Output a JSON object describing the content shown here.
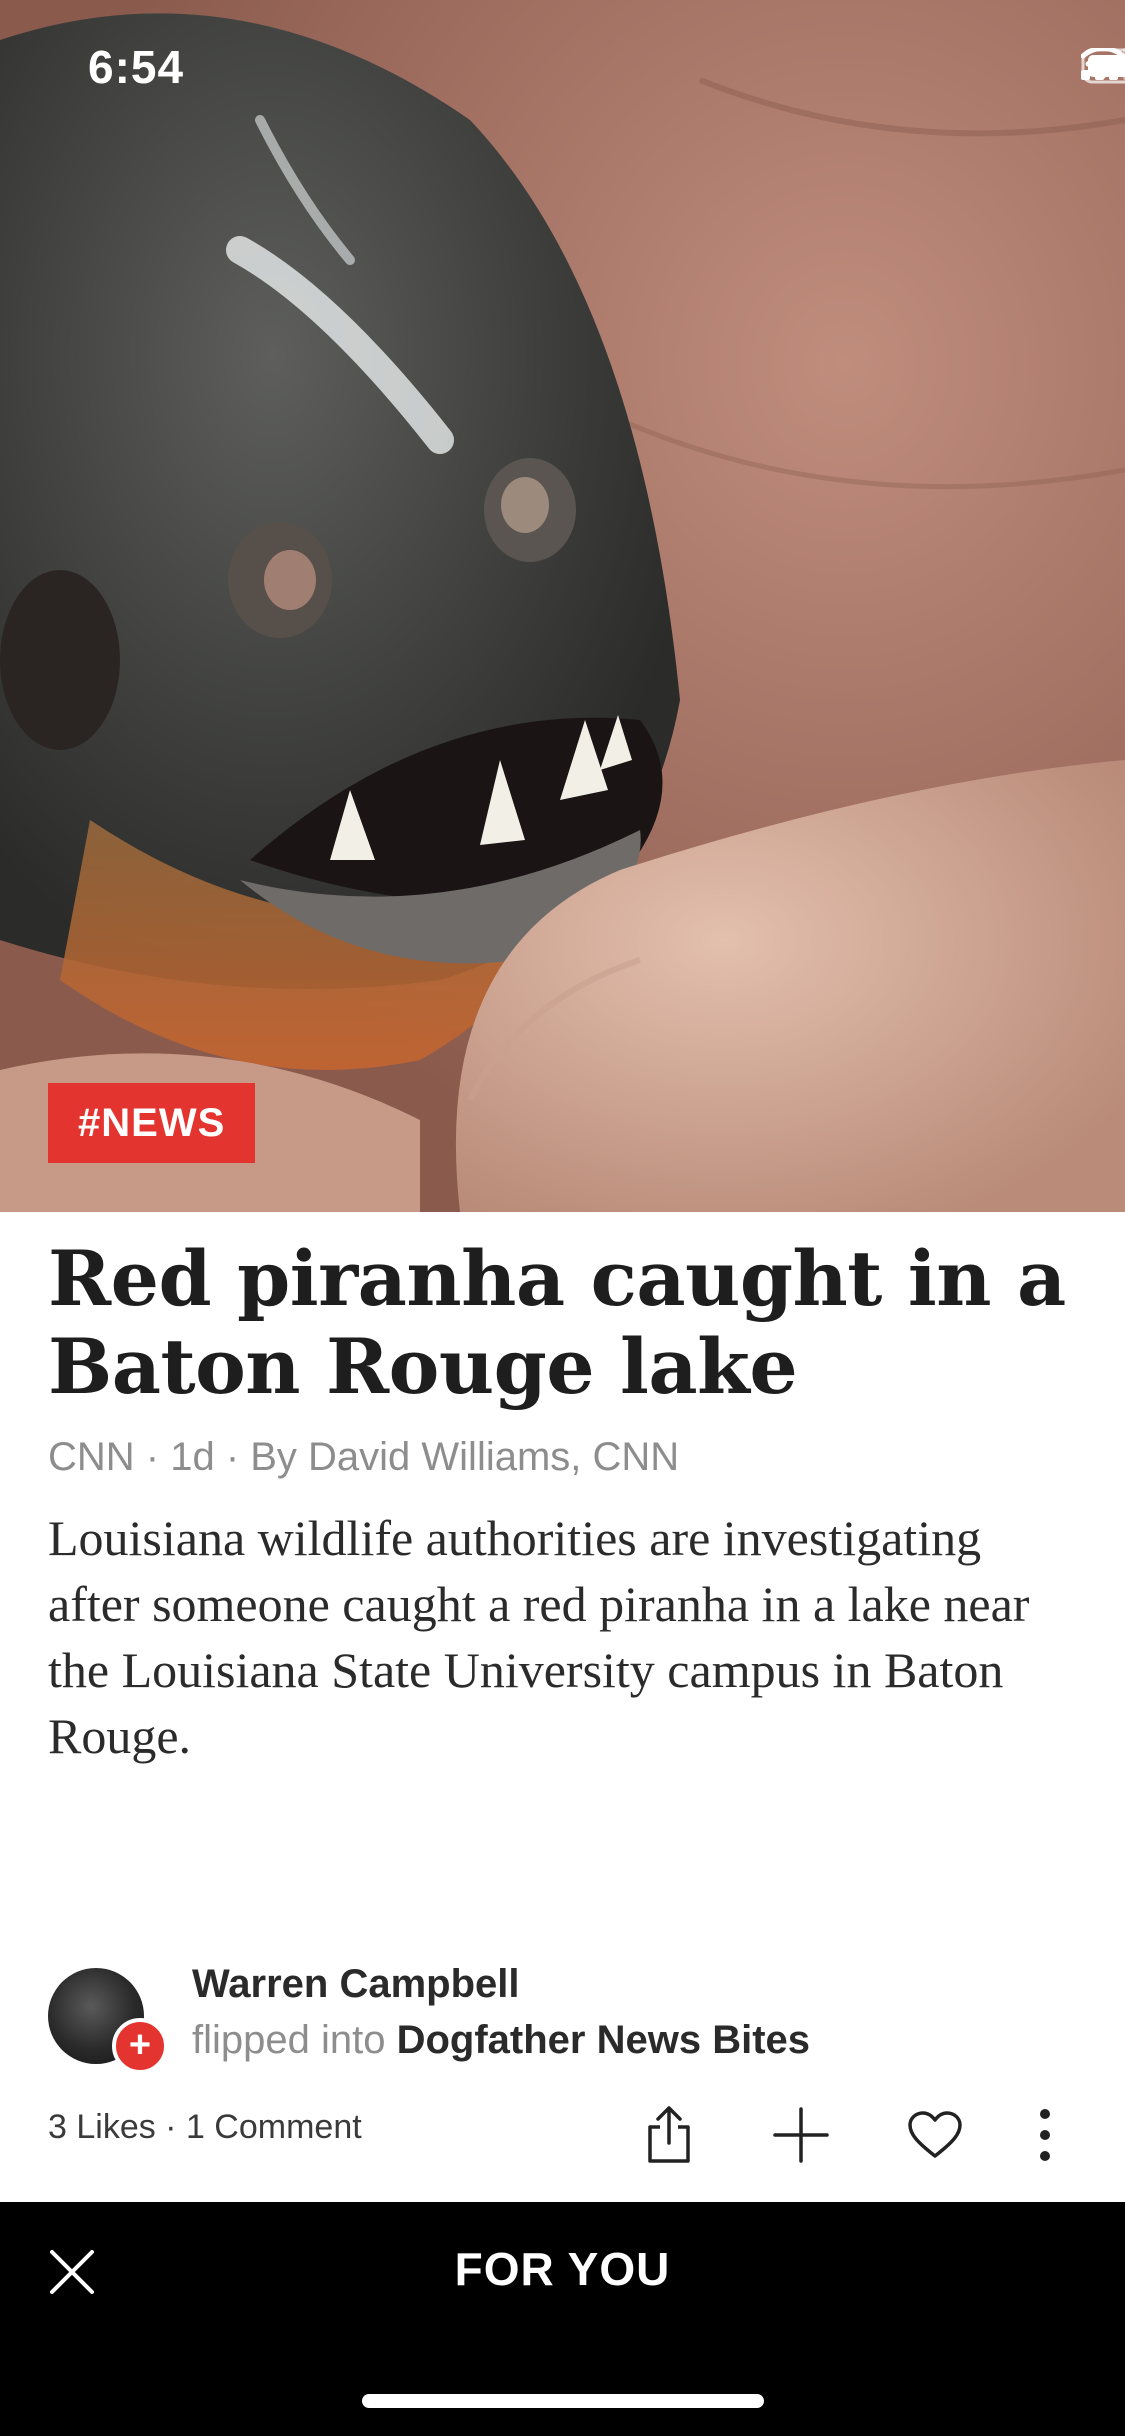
{
  "status_bar": {
    "time": "6:54"
  },
  "article": {
    "tag": "#NEWS",
    "title": "Red piranha caught in a Baton Rouge lake",
    "meta": "CNN · 1d · By David Williams, CNN",
    "summary": "Louisiana wildlife authorities are investigating after someone caught a red piranha in a lake near the Louisiana State University campus in Baton Rouge."
  },
  "attribution": {
    "user": "Warren Campbell",
    "action": "flipped into",
    "magazine": "Dogfather News Bites"
  },
  "social": {
    "counts": "3 Likes · 1 Comment"
  },
  "bottom_bar": {
    "title": "FOR YOU"
  },
  "icons": {
    "share": "share-icon",
    "add": "plus-icon",
    "like": "heart-icon",
    "more": "more-vertical-icon",
    "close": "close-icon"
  },
  "colors": {
    "accent": "#e3342f",
    "bottom_bar": "#000000"
  }
}
